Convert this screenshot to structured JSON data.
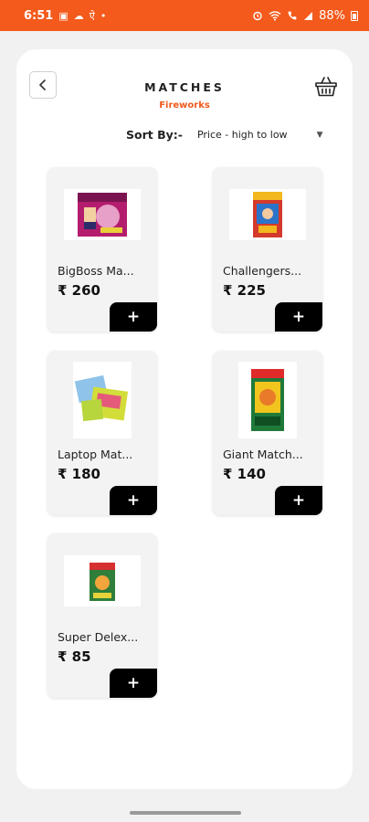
{
  "status_bar": {
    "time": "6:51",
    "battery": "88%",
    "left_icons": [
      "gallery-icon",
      "cloud-icon",
      "devanagari-icon",
      "dot-icon"
    ],
    "right_icons": [
      "alarm-icon",
      "wifi-icon",
      "call-icon",
      "signal-icon",
      "battery-icon"
    ]
  },
  "header": {
    "title": "MATCHES",
    "subtitle": "Fireworks",
    "back_icon": "chevron-left-icon",
    "basket_icon": "basket-icon"
  },
  "sort": {
    "label": "Sort By:-",
    "value": "Price - high to low"
  },
  "products": [
    {
      "name": "BigBoss Ma...",
      "price": "₹ 260"
    },
    {
      "name": "Challengers...",
      "price": "₹ 225"
    },
    {
      "name": "Laptop Mat...",
      "price": "₹ 180"
    },
    {
      "name": "Giant Match...",
      "price": "₹ 140"
    },
    {
      "name": "Super Delex...",
      "price": "₹ 85"
    }
  ],
  "add_label": "+",
  "colors": {
    "status_bar": "#f35a1c",
    "accent": "#f05a1c",
    "add_button": "#000000"
  }
}
